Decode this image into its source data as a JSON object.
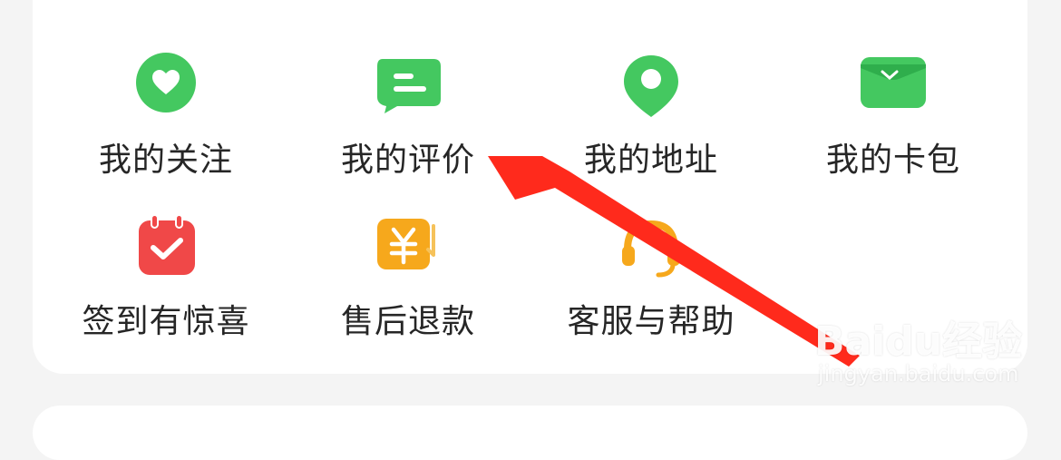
{
  "colors": {
    "green": "#44c860",
    "red": "#f04848",
    "orange": "#f6a81c",
    "arrow": "#ff2a1c"
  },
  "grid": {
    "items": [
      {
        "label": "我的关注",
        "icon": "heart-icon"
      },
      {
        "label": "我的评价",
        "icon": "comment-icon"
      },
      {
        "label": "我的地址",
        "icon": "location-pin-icon"
      },
      {
        "label": "我的卡包",
        "icon": "wallet-icon"
      },
      {
        "label": "签到有惊喜",
        "icon": "calendar-check-icon"
      },
      {
        "label": "售后退款",
        "icon": "yen-refund-icon"
      },
      {
        "label": "客服与帮助",
        "icon": "headset-icon"
      }
    ]
  },
  "watermark": {
    "logo": "Baidu经验",
    "url": "jingyan.baidu.com"
  }
}
